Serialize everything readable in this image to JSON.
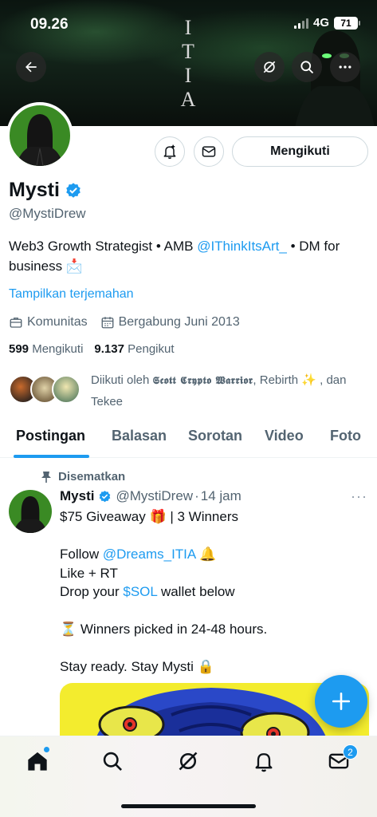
{
  "status": {
    "time": "09.26",
    "network": "4G",
    "battery": "71"
  },
  "banner": {
    "title_letters": [
      "I",
      "T",
      "I",
      "A"
    ]
  },
  "profile": {
    "follow_label": "Mengikuti",
    "name": "Mysti",
    "handle": "@MystiDrew",
    "bio": {
      "part1": "Web3 Growth Strategist • AMB ",
      "mention": "@IThinkItsArt_",
      "part2": " • DM for business 📩"
    },
    "translate_label": "Tampilkan terjemahan",
    "category": "Komunitas",
    "joined": "Bergabung Juni 2013",
    "following_count": "599",
    "following_label": "Mengikuti",
    "followers_count": "9.137",
    "followers_label": "Pengikut",
    "followed_by": {
      "prefix": "Diikuti oleh ",
      "name1": "𝕾𝖈𝖔𝖙𝖙 𝕮𝖗𝖞𝖕𝖙𝖔 𝖂𝖆𝖗𝖗𝖎𝖔𝖗",
      "middle": ", Rebirth ✨ , dan Tekee"
    }
  },
  "tabs": [
    {
      "label": "Postingan",
      "active": true
    },
    {
      "label": "Balasan",
      "active": false
    },
    {
      "label": "Sorotan",
      "active": false
    },
    {
      "label": "Video",
      "active": false
    },
    {
      "label": "Foto",
      "active": false
    }
  ],
  "tweet": {
    "pinned_label": "Disematkan",
    "name": "Mysti",
    "handle": "@MystiDrew",
    "sep": "·",
    "time": "14 jam",
    "more": "···",
    "lines": {
      "l1": "$75 Giveaway 🎁 | 3 Winners",
      "l3_prefix": "Follow ",
      "l3_mention": "@Dreams_ITIA",
      "l3_suffix": " 🔔",
      "l4": "Like + RT",
      "l5_prefix": "Drop your ",
      "l5_cashtag": "$SOL",
      "l5_suffix": " wallet below",
      "l7": "⏳ Winners picked in 24-48 hours.",
      "l9": "Stay ready. Stay Mysti 🔒"
    }
  },
  "nav": {
    "messages_badge": "2"
  },
  "colors": {
    "accent": "#1d9bf0",
    "avatar_green": "#3a8a24"
  }
}
